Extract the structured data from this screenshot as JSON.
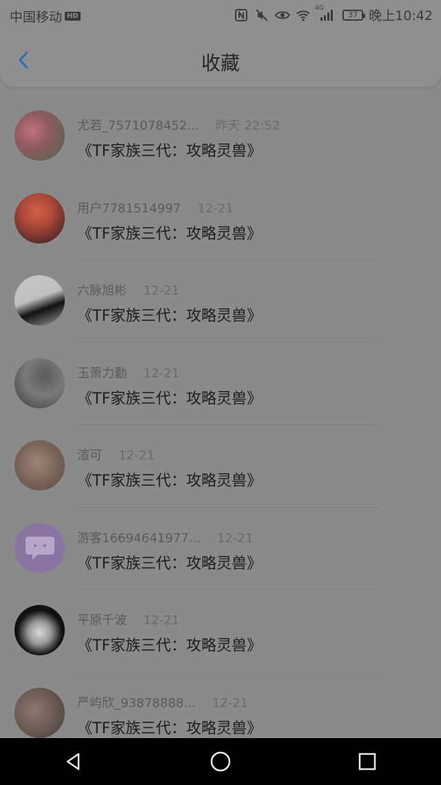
{
  "statusbar": {
    "carrier": "中国移动",
    "hd_badge": "HD",
    "network": "4G",
    "battery": "37",
    "time": "晚上10:42"
  },
  "header": {
    "title": "收藏",
    "back_icon": "chevron-left-icon",
    "accent_color": "#2b6fb6"
  },
  "items": [
    {
      "user": "尤若_7571078452...",
      "date": "昨天 22:52",
      "content": "《TF家族三代：攻略灵兽》",
      "avatar_colors": [
        "#c0737a",
        "#4a6a48"
      ]
    },
    {
      "user": "用户7781514997",
      "date": "12-21",
      "content": "《TF家族三代：攻略灵兽》",
      "avatar_colors": [
        "#b04a3a",
        "#2a1a1a"
      ]
    },
    {
      "user": "六脉旭彬",
      "date": "12-21",
      "content": "《TF家族三代：攻略灵兽》",
      "avatar_colors": [
        "#bfbfbf",
        "#111111"
      ]
    },
    {
      "user": "玉萧力勤",
      "date": "12-21",
      "content": "《TF家族三代：攻略灵兽》",
      "avatar_colors": [
        "#7a7a7a",
        "#3a3a3a"
      ]
    },
    {
      "user": "渲可",
      "date": "12-21",
      "content": "《TF家族三代：攻略灵兽》",
      "avatar_colors": [
        "#a08478",
        "#5a4a44"
      ]
    },
    {
      "user": "游客16694641977...",
      "date": "12-21",
      "content": "《TF家族三代：攻略灵兽》",
      "avatar_colors": [
        "#9a82b0",
        "#8a74a2"
      ]
    },
    {
      "user": "平原千波",
      "date": "12-21",
      "content": "《TF家族三代：攻略灵兽》",
      "avatar_colors": [
        "#d8d8d8",
        "#111111"
      ]
    },
    {
      "user": "严屿欣_93878888...",
      "date": "12-21",
      "content": "《TF家族三代：攻略灵兽》",
      "avatar_colors": [
        "#8a7a70",
        "#4a3a34"
      ]
    }
  ],
  "navbar": {
    "back": "triangle-back-icon",
    "home": "circle-home-icon",
    "recents": "square-recents-icon"
  }
}
